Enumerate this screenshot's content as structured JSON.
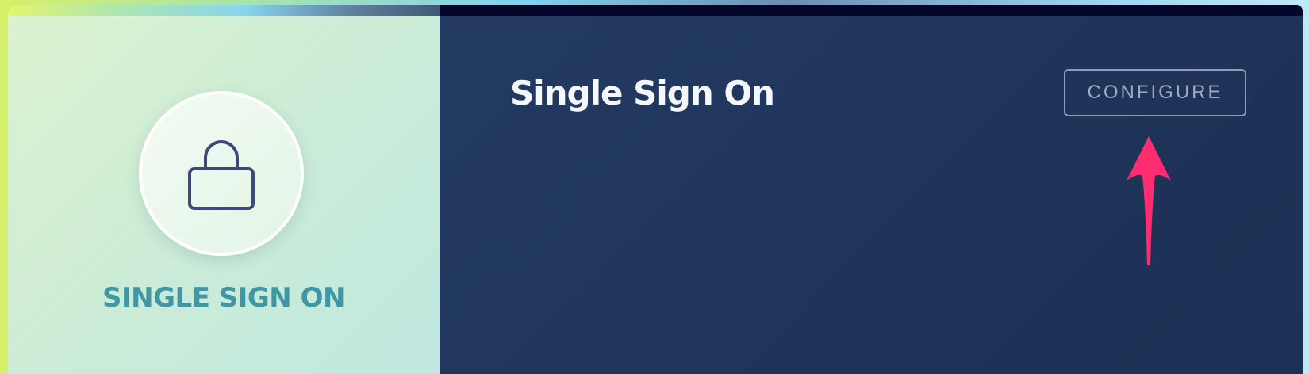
{
  "card": {
    "left_title": "SINGLE SIGN ON",
    "icon": "lock-icon",
    "title": "Single Sign On",
    "configure_label": "CONFIGURE"
  },
  "annotation": {
    "icon": "arrow-up-icon",
    "color": "#ff2d6f"
  },
  "colors": {
    "left_title": "#3f97a6",
    "right_bg": "#1f3459",
    "button_border": "#8e9bb5"
  }
}
